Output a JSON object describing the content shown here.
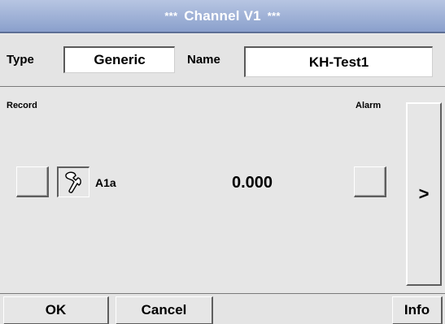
{
  "header": {
    "stars_left": "***",
    "title": "Channel V1",
    "stars_right": "***"
  },
  "type_row": {
    "type_label": "Type",
    "type_value": "Generic",
    "name_label": "Name",
    "name_value": "KH-Test1"
  },
  "channel": {
    "record_label": "Record",
    "alarm_label": "Alarm",
    "channel_id": "A1a",
    "value": "0.000",
    "next_label": ">"
  },
  "footer": {
    "ok_label": "OK",
    "cancel_label": "Cancel",
    "info_label": "Info"
  },
  "colors": {
    "titlebar": "#8aa0cc",
    "background": "#e6e6e6"
  }
}
